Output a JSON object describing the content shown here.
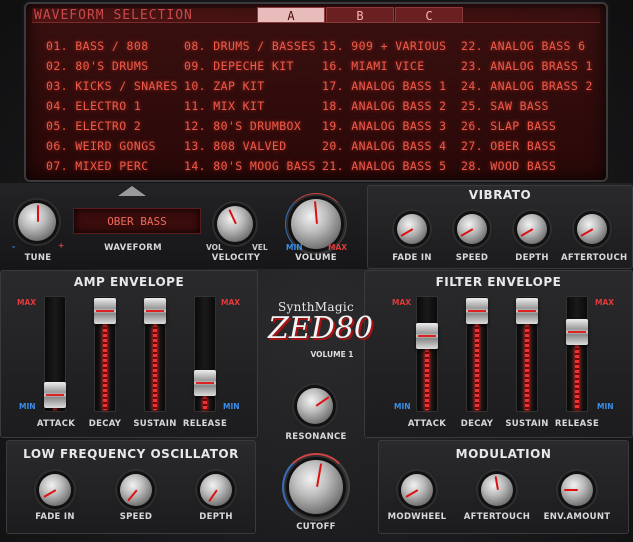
{
  "lcd": {
    "title": "WAVEFORM SELECTION",
    "tabs": [
      "A",
      "B",
      "C"
    ],
    "active_tab": "A",
    "columns": [
      [
        "01. BASS / 808",
        "02. 80'S DRUMS",
        "03. KICKS / SNARES",
        "04. ELECTRO 1",
        "05. ELECTRO 2",
        "06. WEIRD GONGS",
        "07. MIXED PERC"
      ],
      [
        "08. DRUMS / BASSES",
        "09. DEPECHE KIT",
        "10. ZAP KIT",
        "11. MIX KIT",
        "12. 80'S DRUMBOX",
        "13. 808 VALVED",
        "14. 80'S MOOG BASS"
      ],
      [
        "15. 909 + VARIOUS",
        "16. MIAMI VICE",
        "17. ANALOG BASS 1",
        "18. ANALOG BASS 2",
        "19. ANALOG BASS 3",
        "20. ANALOG BASS 4",
        "21. ANALOG BASS 5"
      ],
      [
        "22. ANALOG BASS 6",
        "23. ANALOG BRASS 1",
        "24. ANALOG BRASS 2",
        "25. SAW BASS",
        "26. SLAP BASS",
        "27. OBER BASS",
        "28. WOOD BASS"
      ]
    ]
  },
  "top": {
    "tune_label": "TUNE",
    "tune_minus": "-",
    "tune_plus": "+",
    "waveform_value": "OBER BASS",
    "waveform_label": "WAVEFORM",
    "velocity_label": "VELOCITY",
    "velocity_vol": "VOL",
    "velocity_vel": "VEL",
    "volume_label": "VOLUME",
    "volume_min": "MIN",
    "volume_max": "MAX"
  },
  "vibrato": {
    "title": "VIBRATO",
    "labels": [
      "FADE IN",
      "SPEED",
      "DEPTH",
      "AFTERTOUCH"
    ]
  },
  "amp": {
    "title": "AMP ENVELOPE",
    "max": "MAX",
    "min": "MIN",
    "labels": [
      "ATTACK",
      "DECAY",
      "SUSTAIN",
      "RELEASE"
    ],
    "levels": [
      0.05,
      0.98,
      0.98,
      0.18
    ]
  },
  "logo": {
    "brand": "SynthMagic",
    "model": "ZED80",
    "volume": "VOLUME 1"
  },
  "filter": {
    "title": "FILTER ENVELOPE",
    "max": "MAX",
    "min": "MIN",
    "labels": [
      "ATTACK",
      "DECAY",
      "SUSTAIN",
      "RELEASE"
    ],
    "levels": [
      0.7,
      0.98,
      0.98,
      0.75
    ]
  },
  "center": {
    "resonance_label": "RESONANCE",
    "cutoff_label": "CUTOFF"
  },
  "lfo": {
    "title": "LOW FREQUENCY OSCILLATOR",
    "labels": [
      "FADE IN",
      "SPEED",
      "DEPTH"
    ]
  },
  "modulation": {
    "title": "MODULATION",
    "labels": [
      "MODWHEEL",
      "AFTERTOUCH",
      "ENV.AMOUNT"
    ]
  },
  "colors": {
    "accent_red": "#e23a3a",
    "accent_blue": "#3a8ee8",
    "lcd_text": "#ee5a4a"
  }
}
